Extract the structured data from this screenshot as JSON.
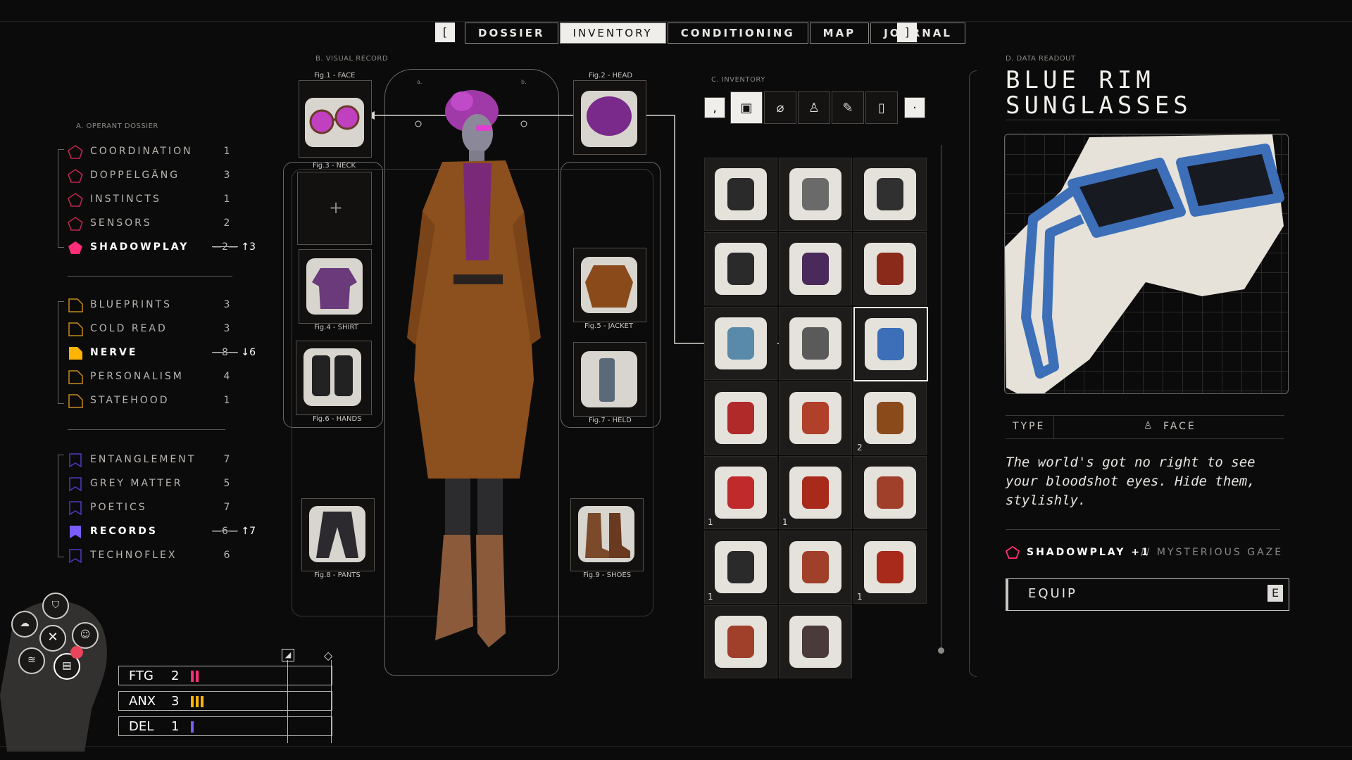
{
  "nav": {
    "left_bracket": "[",
    "right_bracket": "]",
    "tabs": [
      {
        "label": "DOSSIER",
        "active": false
      },
      {
        "label": "INVENTORY",
        "active": true
      },
      {
        "label": "CONDITIONING",
        "active": false
      },
      {
        "label": "MAP",
        "active": false
      },
      {
        "label": "JOURNAL",
        "active": false
      }
    ]
  },
  "sections": {
    "dossier": "A. OPERANT DOSSIER",
    "visual": "B. VISUAL RECORD",
    "inventory": "C. INVENTORY",
    "readout": "D. DATA READOUT"
  },
  "stats": {
    "group1": [
      {
        "name": "COORDINATION",
        "value": "1",
        "color": "#e0305a"
      },
      {
        "name": "DOPPELGÄNG",
        "value": "3",
        "color": "#e0305a"
      },
      {
        "name": "INSTINCTS",
        "value": "1",
        "color": "#e0305a"
      },
      {
        "name": "SENSORS",
        "value": "2",
        "color": "#e0305a"
      },
      {
        "name": "SHADOWPLAY",
        "old": "2",
        "new": "↑3",
        "color": "#ff2e78",
        "highlight": true
      }
    ],
    "group2": [
      {
        "name": "BLUEPRINTS",
        "value": "3",
        "color": "#e0a020"
      },
      {
        "name": "COLD READ",
        "value": "3",
        "color": "#e0a020"
      },
      {
        "name": "NERVE",
        "old": "8",
        "new": "↓6",
        "color": "#ffb400",
        "highlight": true
      },
      {
        "name": "PERSONALISM",
        "value": "4",
        "color": "#e0a020"
      },
      {
        "name": "STATEHOOD",
        "value": "1",
        "color": "#e0a020"
      }
    ],
    "group3": [
      {
        "name": "ENTANGLEMENT",
        "value": "7",
        "color": "#5a46d0"
      },
      {
        "name": "GREY MATTER",
        "value": "5",
        "color": "#5a46d0"
      },
      {
        "name": "POETICS",
        "value": "7",
        "color": "#5a46d0"
      },
      {
        "name": "RECORDS",
        "old": "6",
        "new": "↑7",
        "color": "#7a5cff",
        "highlight": true
      },
      {
        "name": "TECHNOFLEX",
        "value": "6",
        "color": "#5a46d0"
      }
    ]
  },
  "slots": {
    "face": "Fig.1 - FACE",
    "head": "Fig.2 - HEAD",
    "neck": "Fig.3 - NECK",
    "shirt": "Fig.4 - SHIRT",
    "jacket": "Fig.5 - JACKET",
    "hands": "Fig.6 - HANDS",
    "held": "Fig.7 - HELD",
    "pants": "Fig.8 - PANTS",
    "shoes": "Fig.9 - SHOES",
    "empty_glyph": "+",
    "figure_markers": [
      "a.",
      "b."
    ]
  },
  "inventory": {
    "tools": [
      {
        "glyph": "‚",
        "name": "prev-filter-icon"
      },
      {
        "glyph": "▣",
        "name": "all-items-icon",
        "active": true
      },
      {
        "glyph": "⌀",
        "name": "consumables-icon"
      },
      {
        "glyph": "♙",
        "name": "clothing-icon"
      },
      {
        "glyph": "✎",
        "name": "tools-icon"
      },
      {
        "glyph": "▯",
        "name": "documents-icon"
      },
      {
        "glyph": "·",
        "name": "next-filter-icon"
      }
    ],
    "cells": [
      {
        "kind": "boots",
        "count": ""
      },
      {
        "kind": "goggles",
        "count": ""
      },
      {
        "kind": "pants-dark",
        "count": ""
      },
      {
        "kind": "jacket-dark",
        "count": ""
      },
      {
        "kind": "boots-purple",
        "count": ""
      },
      {
        "kind": "scarf",
        "count": ""
      },
      {
        "kind": "tshirt",
        "count": ""
      },
      {
        "kind": "gadget",
        "count": ""
      },
      {
        "kind": "sunglasses-selected",
        "count": ""
      },
      {
        "kind": "book",
        "count": ""
      },
      {
        "kind": "tube",
        "count": ""
      },
      {
        "kind": "bottle",
        "count": "2"
      },
      {
        "kind": "ketchup",
        "count": "1"
      },
      {
        "kind": "sauce-bottle",
        "count": "1"
      },
      {
        "kind": "noodles",
        "count": ""
      },
      {
        "kind": "box",
        "count": "1"
      },
      {
        "kind": "noodles",
        "count": ""
      },
      {
        "kind": "sauce-bottle",
        "count": "1"
      },
      {
        "kind": "noodles",
        "count": ""
      },
      {
        "kind": "mask",
        "count": ""
      }
    ]
  },
  "readout": {
    "title_line1": "BLUE RIM",
    "title_line2": "SUNGLASSES",
    "type_label": "TYPE",
    "type_value": "FACE",
    "description": "The world's got no right to see your bloodshot eyes. Hide them, stylishly.",
    "bonus_stat": "SHADOWPLAY +1",
    "bonus_note": "// MYSTERIOUS GAZE",
    "equip_label": "EQUIP",
    "equip_key": "E"
  },
  "psych": [
    {
      "label": "FTG",
      "value": "2",
      "bars": 2,
      "color": "#ff2e78"
    },
    {
      "label": "ANX",
      "value": "3",
      "bars": 3,
      "color": "#ffb400"
    },
    {
      "label": "DEL",
      "value": "1",
      "bars": 1,
      "color": "#7a5cff"
    }
  ],
  "colors": {
    "accent_pink": "#ff2e78",
    "accent_amber": "#ffb400",
    "accent_violet": "#7a5cff",
    "sunglasses_blue": "#3d6fb8"
  }
}
